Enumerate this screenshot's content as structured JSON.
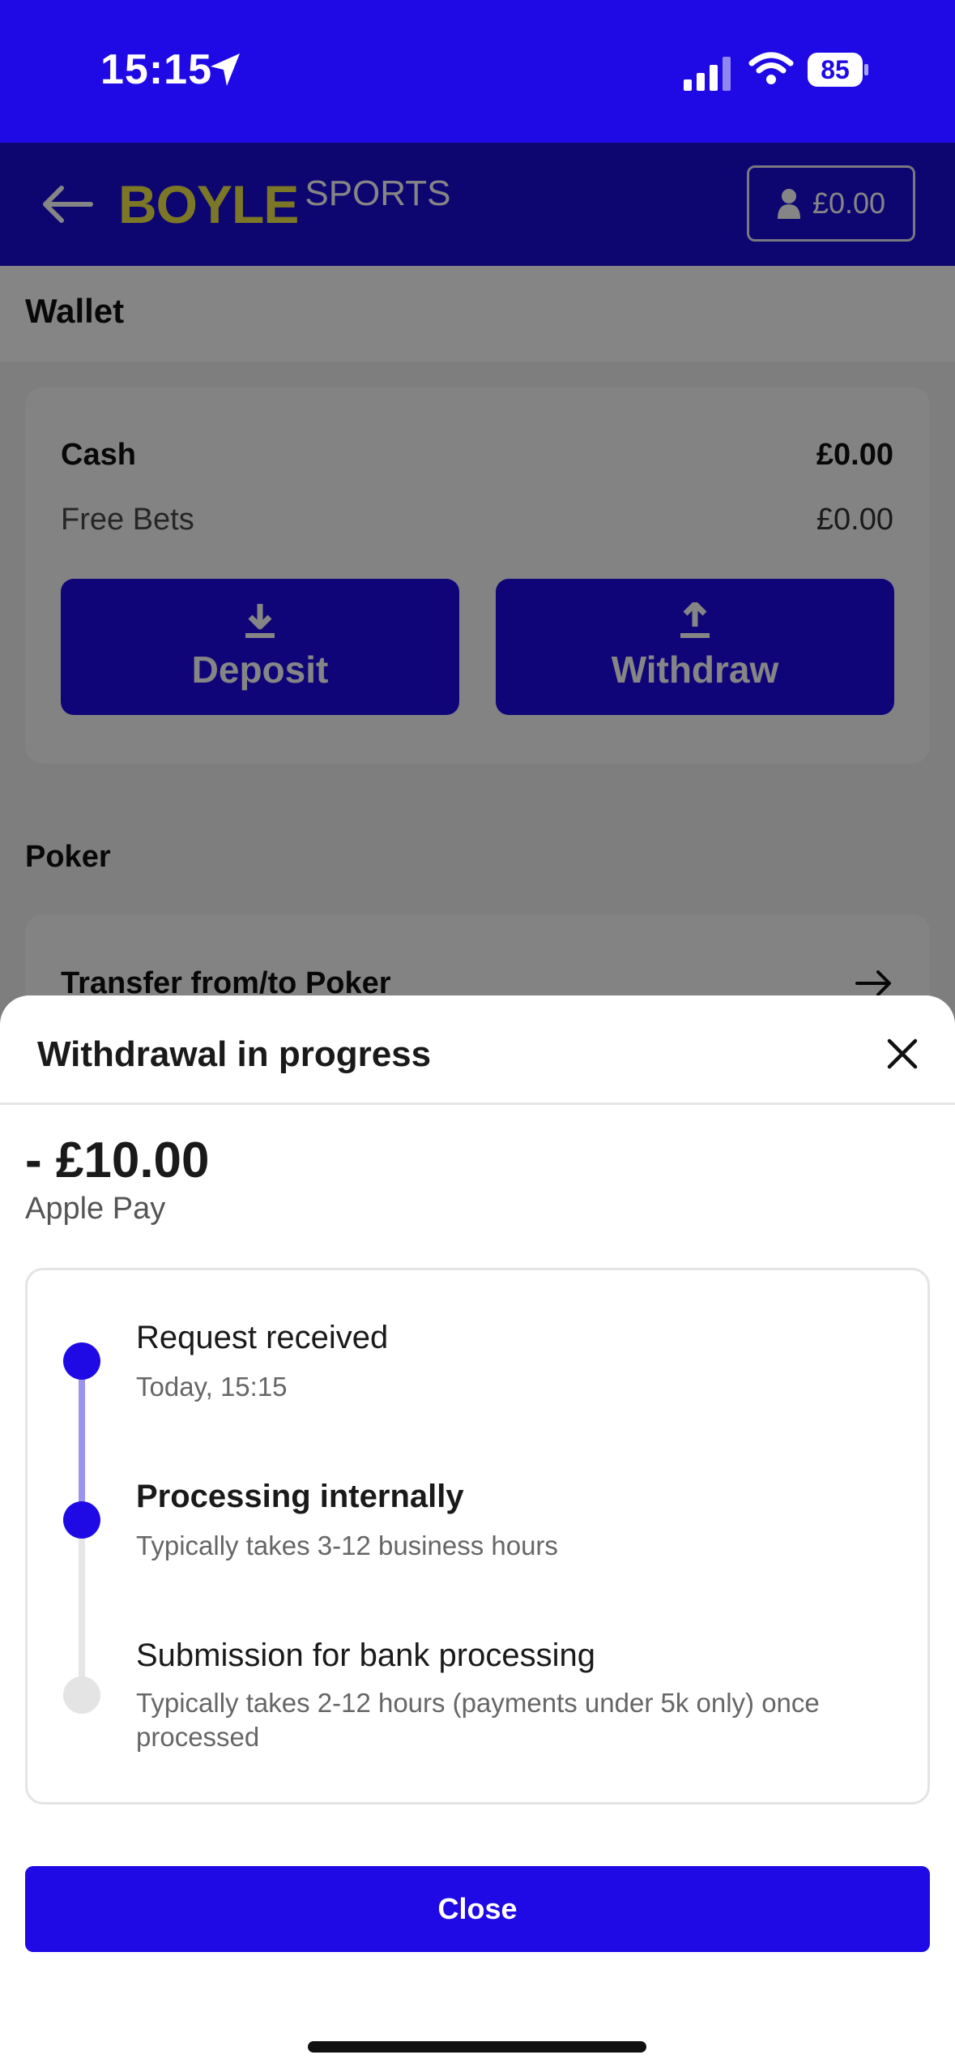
{
  "status_bar": {
    "time": "15:15",
    "battery": "85"
  },
  "header": {
    "logo_main": "BOYLE",
    "logo_sub": "SPORTS",
    "balance": "£0.00"
  },
  "wallet": {
    "title": "Wallet",
    "cash_label": "Cash",
    "cash_value": "£0.00",
    "free_bets_label": "Free Bets",
    "free_bets_value": "£0.00",
    "deposit_label": "Deposit",
    "withdraw_label": "Withdraw"
  },
  "poker": {
    "title": "Poker",
    "transfer_label": "Transfer from/to Poker"
  },
  "sheet": {
    "title": "Withdrawal in progress",
    "amount": "- £10.00",
    "method": "Apple Pay",
    "steps": [
      {
        "title": "Request received",
        "subtitle": "Today, 15:15",
        "state": "done"
      },
      {
        "title": "Processing internally",
        "subtitle": "Typically takes 3-12 business hours",
        "state": "current"
      },
      {
        "title": "Submission for bank processing",
        "subtitle": "Typically takes 2-12 hours (payments under 5k only) once processed",
        "state": "pending"
      }
    ],
    "close_label": "Close"
  },
  "colors": {
    "brand_blue": "#1f0ae6",
    "header_blue": "#1a0ad6",
    "logo_yellow": "#ede44a",
    "timeline_active": "#9b93f0",
    "timeline_pending": "#e4e4e4"
  }
}
